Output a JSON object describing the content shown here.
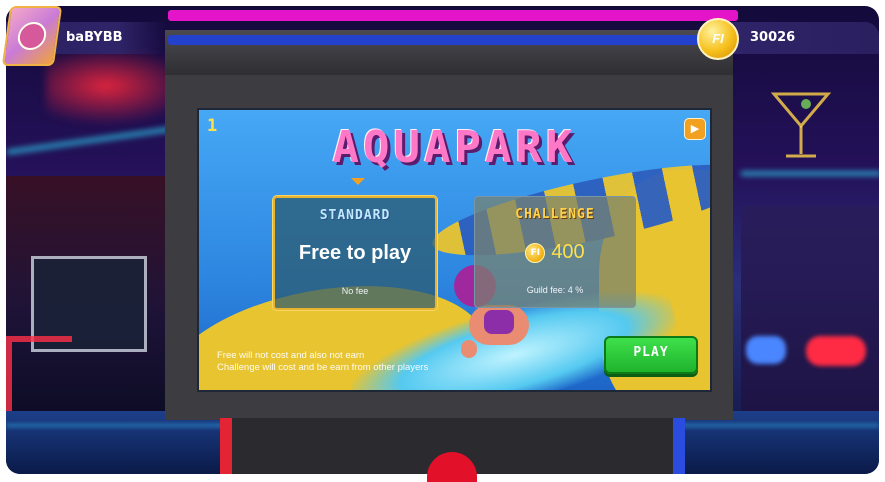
{
  "hud": {
    "username": "baBYBB",
    "coin_symbol": "FI",
    "balance": "30026"
  },
  "game": {
    "level": "1",
    "title": "AQUAPARK",
    "standard": {
      "heading": "STANDARD",
      "main": "Free to play",
      "fee": "No fee"
    },
    "challenge": {
      "heading": "CHALLENGE",
      "price": "400",
      "coin_symbol": "FI",
      "fee": "Guild fee: 4 %"
    },
    "info_line_1": "Free will not cost and also not earn",
    "info_line_2": "Challenge will cost and be earn from other players",
    "play_label": "PLAY"
  },
  "colors": {
    "title_pink": "#ff78c8",
    "play_green": "#2ec93c",
    "coin_gold": "#f6c01c",
    "cabinet_magenta": "#e414c9",
    "cabinet_blue": "#2341cc"
  },
  "icons": {
    "coin": "fi-coin-icon",
    "screen_button": "play-triangle-icon",
    "avatar": "user-avatar"
  }
}
